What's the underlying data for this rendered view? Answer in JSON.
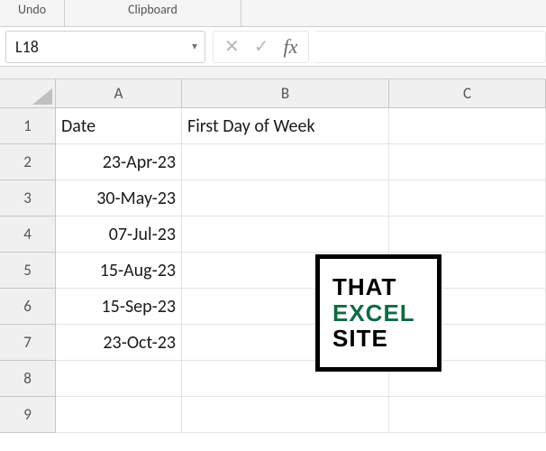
{
  "ribbon": {
    "undo_label": "Undo",
    "clipboard_label": "Clipboard"
  },
  "namebox": {
    "value": "L18"
  },
  "formula": {
    "fx_label": "fx",
    "value": ""
  },
  "columns": [
    "A",
    "B",
    "C"
  ],
  "row_numbers": [
    "1",
    "2",
    "3",
    "4",
    "5",
    "6",
    "7",
    "8",
    "9"
  ],
  "sheet": {
    "r1": {
      "a": "Date",
      "b": "First Day of Week"
    },
    "r2": {
      "a": "23-Apr-23"
    },
    "r3": {
      "a": "30-May-23"
    },
    "r4": {
      "a": "07-Jul-23"
    },
    "r5": {
      "a": "15-Aug-23"
    },
    "r6": {
      "a": "15-Sep-23"
    },
    "r7": {
      "a": "23-Oct-23"
    }
  },
  "logo": {
    "line1": "THAT",
    "line2": "EXCEL",
    "line3": "SITE"
  }
}
